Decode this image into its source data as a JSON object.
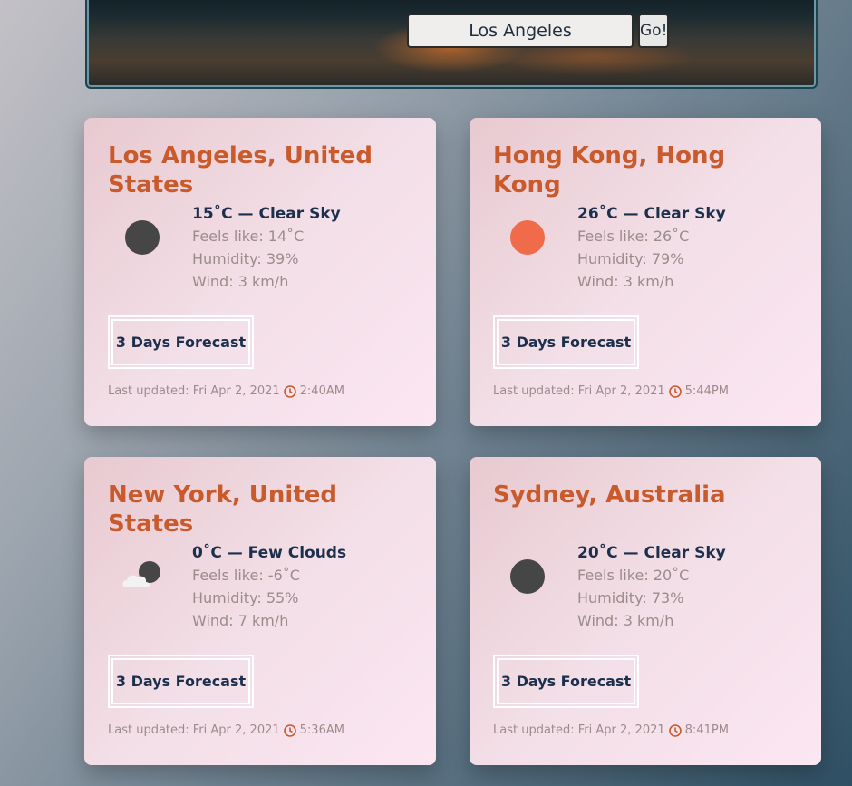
{
  "search": {
    "value": "Los Angeles",
    "go_label": "Go!"
  },
  "cards": [
    {
      "city": "Los Angeles, United States",
      "summary": "15˚C — Clear Sky",
      "feels": "Feels like: 14˚C",
      "humidity": "Humidity: 39%",
      "wind": "Wind: 3 km/h",
      "forecast_label": "3 Days Forecast",
      "updated": "Last updated: Fri Apr 2, 2021",
      "time": "2:40AM",
      "icon": "moon-icon"
    },
    {
      "city": "Hong Kong, Hong Kong",
      "summary": "26˚C — Clear Sky",
      "feels": "Feels like: 26˚C",
      "humidity": "Humidity: 79%",
      "wind": "Wind: 3 km/h",
      "forecast_label": "3 Days Forecast",
      "updated": "Last updated: Fri Apr 2, 2021",
      "time": "5:44PM",
      "icon": "sun-icon"
    },
    {
      "city": "New York, United States",
      "summary": "0˚C — Few Clouds",
      "feels": "Feels like: -6˚C",
      "humidity": "Humidity: 55%",
      "wind": "Wind: 7 km/h",
      "forecast_label": "3 Days Forecast",
      "updated": "Last updated: Fri Apr 2, 2021",
      "time": "5:36AM",
      "icon": "cloud-moon-icon"
    },
    {
      "city": "Sydney, Australia",
      "summary": "20˚C — Clear Sky",
      "feels": "Feels like: 20˚C",
      "humidity": "Humidity: 73%",
      "wind": "Wind: 3 km/h",
      "forecast_label": "3 Days Forecast",
      "updated": "Last updated: Fri Apr 2, 2021",
      "time": "8:41PM",
      "icon": "moon-icon"
    }
  ],
  "colors": {
    "accent": "#c85a2c",
    "title_text": "#1c2f4d",
    "muted_text": "#9b8c8c",
    "sun": "#ef6b4a",
    "moon": "#464646"
  }
}
